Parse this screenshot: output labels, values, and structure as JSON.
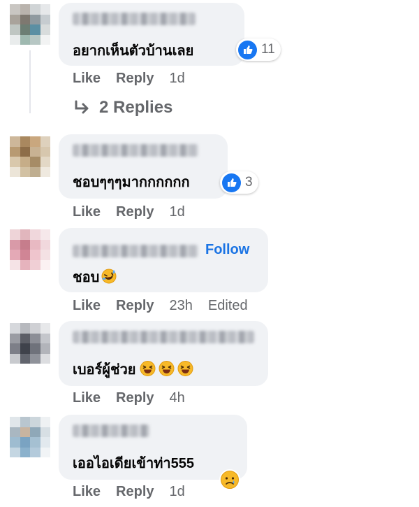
{
  "comments": [
    {
      "text": "อยากเห็นตัวบ้านเลย",
      "reaction_count": "11",
      "like": "Like",
      "reply": "Reply",
      "time": "1d",
      "replies_label": "2 Replies"
    },
    {
      "text": "ชอบๆๆๆมากกกกกก",
      "reaction_count": "3",
      "like": "Like",
      "reply": "Reply",
      "time": "1d"
    },
    {
      "text": "ชอบ",
      "follow": "Follow",
      "like": "Like",
      "reply": "Reply",
      "time": "23h",
      "edited": "Edited"
    },
    {
      "text": "เบอร์ผู้ช่วย",
      "like": "Like",
      "reply": "Reply",
      "time": "4h"
    },
    {
      "text": "เออไอเดียเข้าท่า555",
      "like": "Like",
      "reply": "Reply",
      "time": "1d"
    }
  ],
  "colors": {
    "bubble": "#f0f2f5",
    "like_blue": "#1877f2",
    "link_blue": "#1b74e4",
    "meta_gray": "#65676b"
  },
  "icons": [
    "thumbs-up-icon",
    "reply-arrow-icon",
    "rofl-emoji",
    "laughing-emoji",
    "sad-emoji"
  ]
}
